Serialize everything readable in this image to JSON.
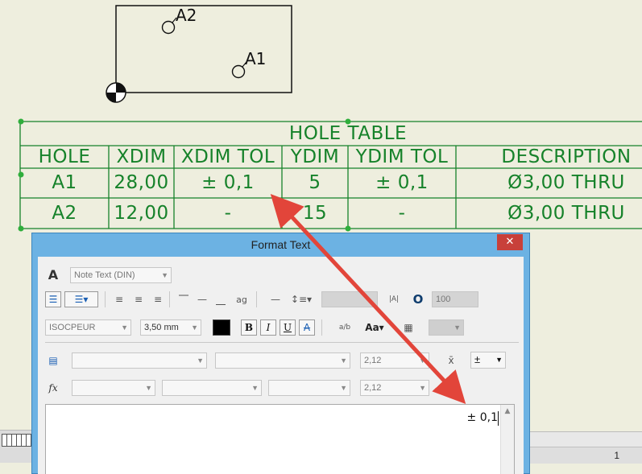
{
  "drawing": {
    "hole_labels": [
      "A2",
      "A1"
    ]
  },
  "hole_table": {
    "title": "HOLE TABLE",
    "columns": [
      "HOLE",
      "XDIM",
      "XDIM TOL",
      "YDIM",
      "YDIM TOL",
      "DESCRIPTION"
    ],
    "rows": [
      [
        "A1",
        "28,00",
        "± 0,1",
        "5",
        "± 0,1",
        "Ø3,00 THRU"
      ],
      [
        "A2",
        "12,00",
        "-",
        "15",
        "-",
        "Ø3,00 THRU"
      ]
    ]
  },
  "dialog": {
    "title": "Format Text",
    "close_glyph": "✕",
    "style_value": "Note Text (DIN)",
    "font_value": "ISOCPEUR",
    "size_value": "3,50 mm",
    "stretch_value": "100",
    "bold_glyph": "B",
    "italic_glyph": "I",
    "underline_glyph": "U",
    "strike_glyph": "A",
    "param_value_1": "2,12",
    "param_value_2": "2,12",
    "symbol_value": "±",
    "editor_text": "± 0,1",
    "fx_label": "fx"
  },
  "status": {
    "page_number": "1"
  },
  "colors": {
    "cad_green": "#16822a",
    "annotation_arrow": "#e2453a",
    "dialog_frame": "#6cb2e3",
    "background": "#eeeede"
  }
}
